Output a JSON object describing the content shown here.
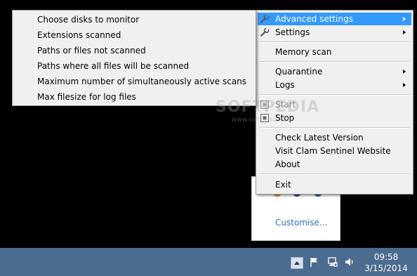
{
  "main_menu": {
    "items": [
      {
        "label": "Advanced settings"
      },
      {
        "label": "Settings"
      },
      {
        "label": "Memory scan"
      },
      {
        "label": "Quarantine"
      },
      {
        "label": "Logs"
      },
      {
        "label": "Start"
      },
      {
        "label": "Stop"
      },
      {
        "label": "Check Latest Version"
      },
      {
        "label": "Visit Clam Sentinel Website"
      },
      {
        "label": "About"
      },
      {
        "label": "Exit"
      }
    ]
  },
  "sub_menu": {
    "items": [
      {
        "label": "Choose disks to monitor"
      },
      {
        "label": "Extensions scanned"
      },
      {
        "label": "Paths or files not scanned"
      },
      {
        "label": "Paths where all files will be scanned"
      },
      {
        "label": "Maximum number of simultaneously active scans"
      },
      {
        "label": "Max filesize for log files"
      }
    ]
  },
  "tray_panel": {
    "customise_label": "Customise..."
  },
  "taskbar": {
    "time": "09:58",
    "date": "3/15/2014"
  },
  "watermark": {
    "text": "SOFTPEDIA",
    "sub": "www.softpedia.com"
  },
  "colors": {
    "highlight": "#3399ff",
    "menu_bg": "#f0f0f0",
    "taskbar_bg": "#4b6b8f",
    "link": "#2f6fbd"
  }
}
